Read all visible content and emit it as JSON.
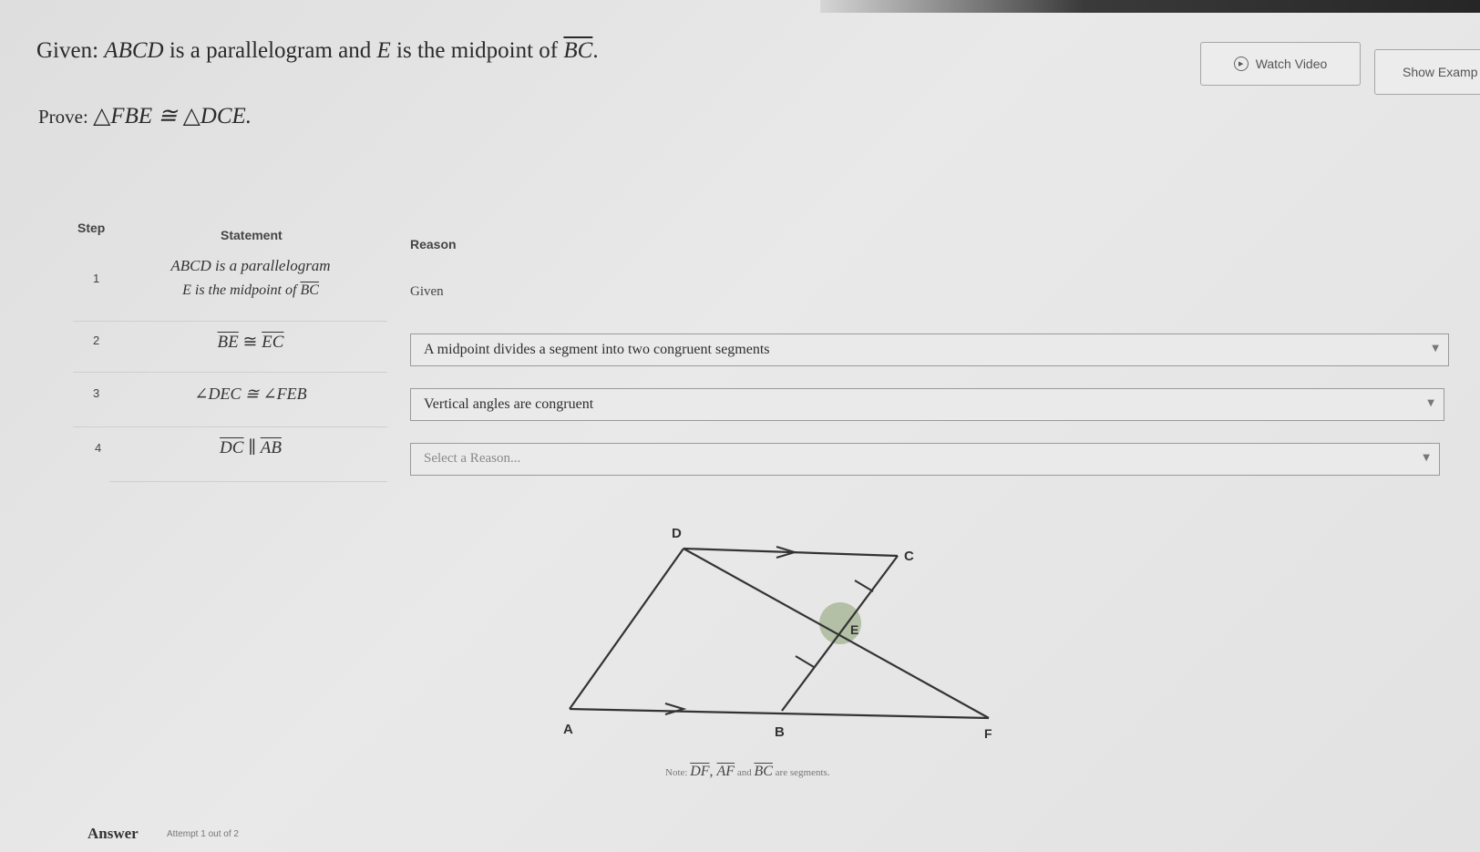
{
  "problem": {
    "given_lead": "Given: ",
    "given_abcd": "ABCD",
    "given_mid1": " is a parallelogram and ",
    "given_e": "E",
    "given_mid2": " is the midpoint of ",
    "given_bc": "BC",
    "given_end": ".",
    "prove_lead": "Prove: ",
    "prove_stmt": "△FBE ≅ △DCE."
  },
  "buttons": {
    "watch_video": "Watch Video",
    "show_examples": "Show Examp"
  },
  "table": {
    "headers": {
      "step": "Step",
      "statement": "Statement",
      "reason": "Reason"
    },
    "rows": [
      {
        "step": "1",
        "statement_a": "ABCD is a parallelogram",
        "statement_b_pre": "E is the midpoint of ",
        "statement_b_seg": "BC",
        "reason": "Given"
      },
      {
        "step": "2",
        "seg1": "BE",
        "rel": " ≅ ",
        "seg2": "EC",
        "reason": "A midpoint divides a segment into two congruent segments"
      },
      {
        "step": "3",
        "statement": "∠DEC ≅ ∠FEB",
        "reason": "Vertical angles are congruent"
      },
      {
        "step": "4",
        "seg1": "DC",
        "rel": " ∥ ",
        "seg2": "AB",
        "reason": "Select a Reason..."
      }
    ]
  },
  "diagram": {
    "labels": {
      "D": "D",
      "C": "C",
      "E": "E",
      "A": "A",
      "B": "B",
      "F": "F"
    }
  },
  "note": {
    "prefix": "Note: ",
    "seg1": "DF",
    "sep": ", ",
    "seg2": "AF",
    "and": " and ",
    "seg3": "BC",
    "suffix": " are segments."
  },
  "answer": {
    "label": "Answer",
    "attempt": "Attempt 1 out of 2"
  },
  "colors": {
    "background": "#e5e5e5",
    "angle_mark": "#a9b89a",
    "line": "#333333"
  },
  "icons": {
    "play": "play-circle-icon",
    "dropdown": "chevron-down-icon"
  }
}
